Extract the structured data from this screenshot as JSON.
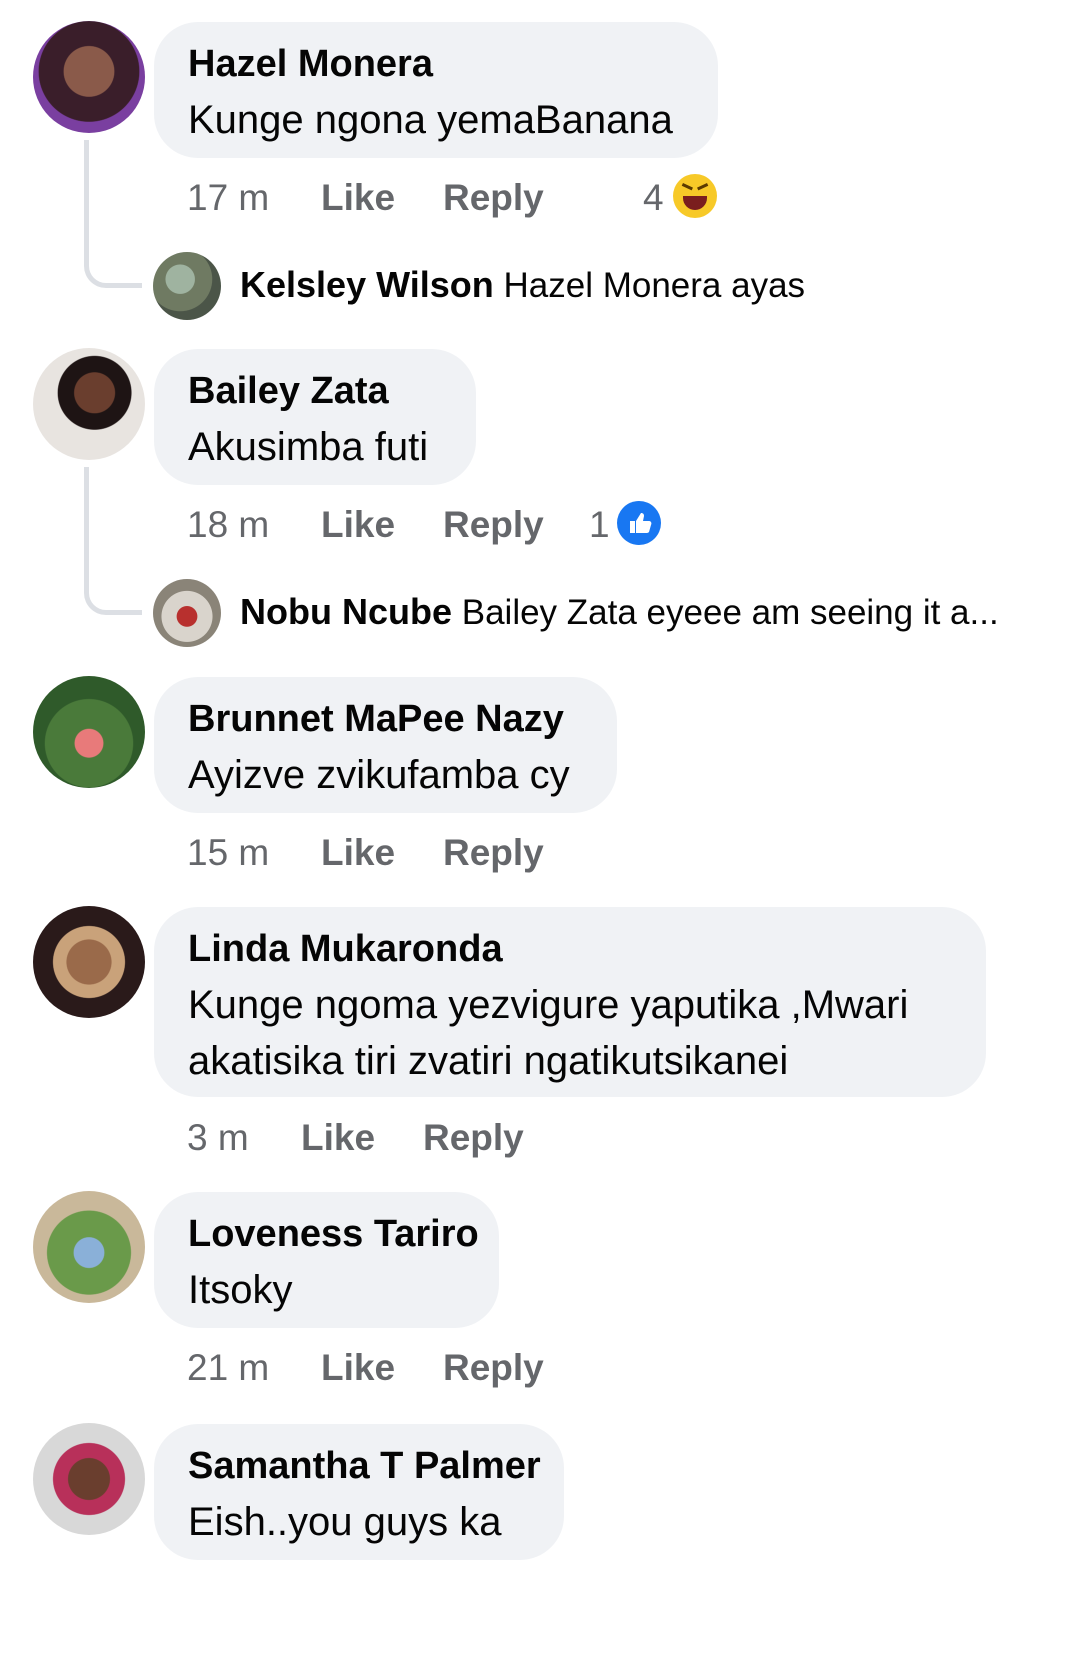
{
  "actions": {
    "like": "Like",
    "reply": "Reply"
  },
  "comments": [
    {
      "name": "Hazel Monera",
      "text": "Kunge ngona yemaBanana",
      "time": "17 m",
      "reaction_count": "4",
      "reaction_icon": "haha-emoji-icon",
      "reply": {
        "name": "Kelsley Wilson",
        "text": "Hazel Monera ayas"
      }
    },
    {
      "name": "Bailey Zata",
      "text": "Akusimba futi",
      "time": "18 m",
      "reaction_count": "1",
      "reaction_icon": "like-reaction-icon",
      "reply": {
        "name": "Nobu Ncube",
        "text": "Bailey Zata eyeee am seeing it a..."
      }
    },
    {
      "name": "Brunnet MaPee Nazy",
      "text": "Ayizve zvikufamba cy",
      "time": "15 m"
    },
    {
      "name": "Linda Mukaronda",
      "text_line1": "Kunge ngoma yezvigure yaputika ,Mwari",
      "text_line2": "akatisika tiri zvatiri ngatikutsikanei",
      "time": "3 m"
    },
    {
      "name": "Loveness Tariro",
      "text": "Itsoky",
      "time": "21 m"
    },
    {
      "name": "Samantha T Palmer",
      "text": "Eish..you guys ka"
    }
  ],
  "colors": {
    "bubble": "#f0f2f5",
    "meta_text": "#65676b",
    "like_blue": "#1877f2",
    "haha_yellow": "#f7c928"
  }
}
